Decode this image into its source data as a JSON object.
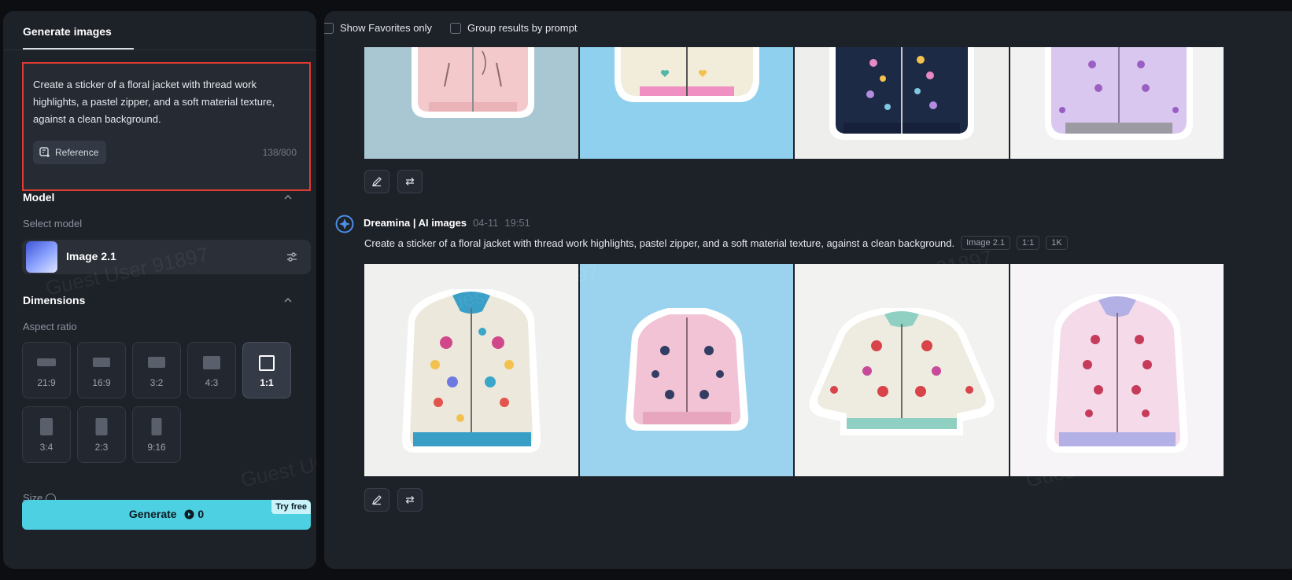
{
  "sidebar": {
    "tab_title": "Generate images",
    "prompt": {
      "text": "Create a sticker of a floral jacket with thread work highlights, a pastel zipper, and a soft material texture, against a clean background.",
      "reference_label": "Reference",
      "counter": "138/800"
    },
    "model": {
      "section_title": "Model",
      "select_label": "Select model",
      "name": "Image 2.1"
    },
    "dimensions": {
      "section_title": "Dimensions",
      "aspect_label": "Aspect ratio",
      "ratios": [
        "21:9",
        "16:9",
        "3:2",
        "4:3",
        "1:1",
        "3:4",
        "2:3",
        "9:16"
      ],
      "selected": "1:1",
      "size_label": "Size"
    },
    "generate": {
      "label": "Generate",
      "cost": "0",
      "badge": "Try free"
    },
    "watermark": "Guest User 91897"
  },
  "main": {
    "filters": {
      "favorites_label": "Show Favorites only",
      "group_label": "Group results by prompt"
    },
    "result": {
      "author": "Dreamina | AI images",
      "date": "04-11",
      "time": "19:51",
      "prompt": "Create a sticker of a floral jacket with thread work highlights, pastel zipper, and a soft material texture, against a clean background.",
      "tags": [
        "Image 2.1",
        "1:1",
        "1K"
      ]
    },
    "watermark": "Guest User 91897"
  },
  "colors": {
    "accent": "#4dd0e1",
    "highlight_border": "#e03b32",
    "panel": "#1d2128",
    "background": "#0c0e12"
  },
  "icons": [
    "reference-add-icon",
    "chevron-up-icon",
    "sliders-icon",
    "coin-icon",
    "pencil-icon",
    "regenerate-icon",
    "dreamina-logo-icon",
    "info-icon"
  ]
}
